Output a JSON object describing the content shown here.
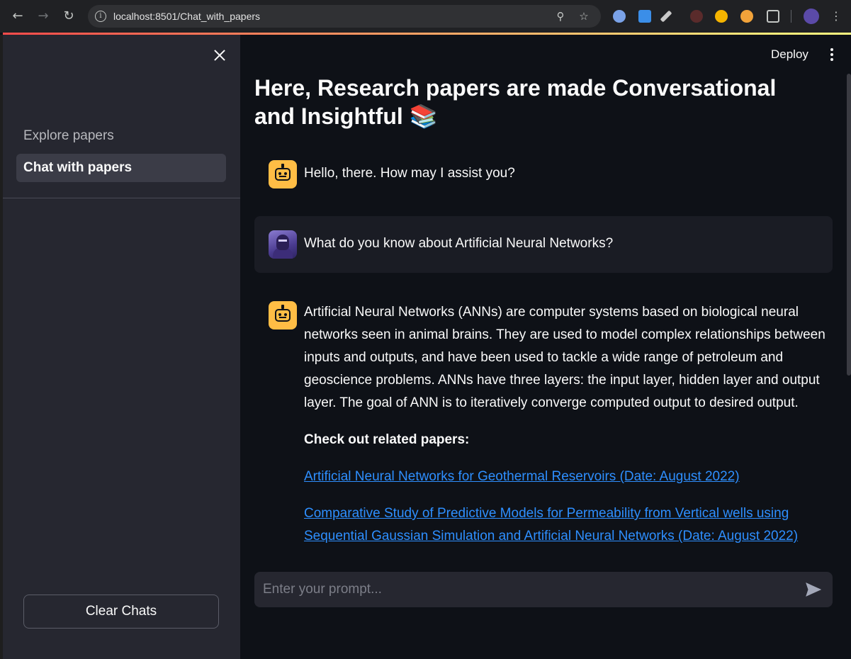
{
  "browser": {
    "url": "localhost:8501/Chat_with_papers",
    "info_glyph": "i"
  },
  "sidebar": {
    "items": [
      {
        "label": "Explore papers",
        "active": false
      },
      {
        "label": "Chat with papers",
        "active": true
      }
    ],
    "clear_button_label": "Clear Chats"
  },
  "header": {
    "deploy_label": "Deploy"
  },
  "main": {
    "title": "Here, Research papers are made Conversational and Insightful 📚",
    "messages": [
      {
        "role": "assistant",
        "text": "Hello, there. How may I assist you?"
      },
      {
        "role": "user",
        "text": "What do you know about Artificial Neural Networks?"
      },
      {
        "role": "assistant",
        "text": "Artificial Neural Networks (ANNs) are computer systems based on biological neural networks seen in animal brains. They are used to model complex relationships between inputs and outputs, and have been used to tackle a wide range of petroleum and geoscience problems. ANNs have three layers: the input layer, hidden layer and output layer. The goal of ANN is to iteratively converge computed output to desired output.",
        "related_heading": "Check out related papers:",
        "links": [
          "Artificial Neural Networks for Geothermal Reservoirs (Date: August 2022)",
          "Comparative Study of Predictive Models for Permeability from Vertical wells using Sequential Gaussian Simulation and Artificial Neural Networks (Date: August 2022)"
        ]
      }
    ]
  },
  "chat_input": {
    "placeholder": "Enter your prompt..."
  },
  "colors": {
    "background": "#0e1117",
    "sidebar": "#262730",
    "accent_bot": "#ffbd45",
    "link": "#2e8fff"
  }
}
